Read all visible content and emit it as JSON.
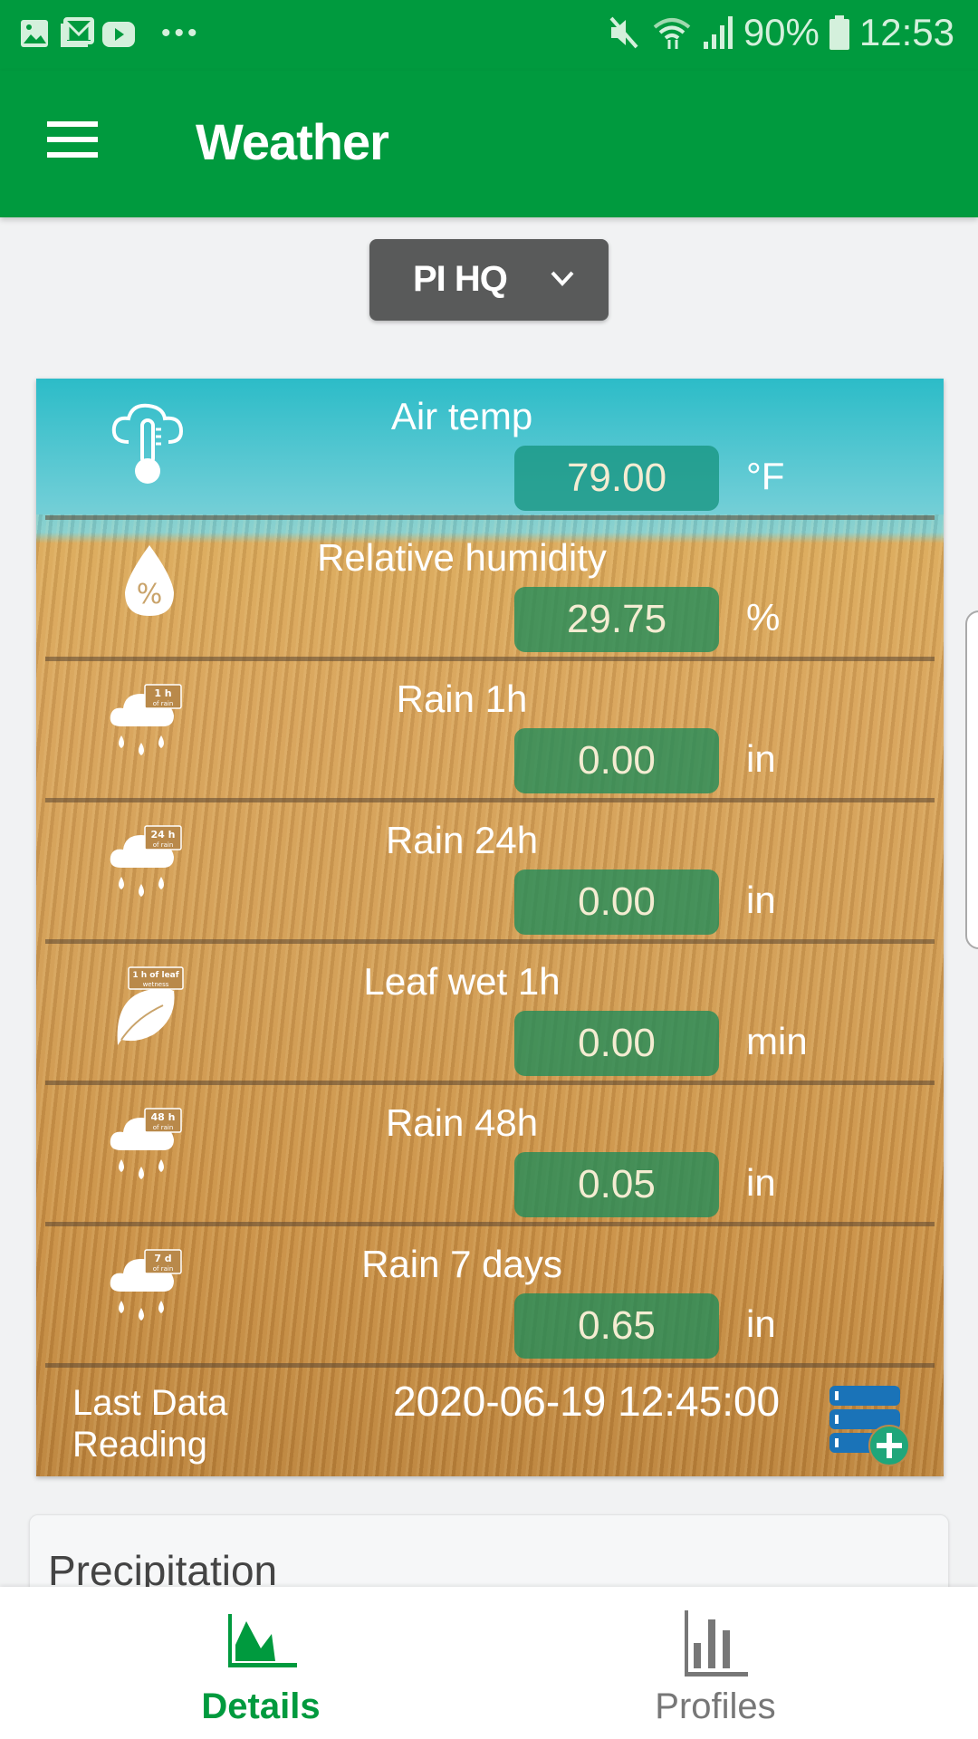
{
  "status_bar": {
    "notification_icons": [
      "gallery-icon",
      "gmail-icon",
      "youtube-icon"
    ],
    "more_indicator": "•••",
    "battery": "90%",
    "time": "12:53"
  },
  "app_bar": {
    "title": "Weather"
  },
  "station_selector": {
    "selected": "PI HQ"
  },
  "readings": [
    {
      "icon": "air-temp-icon",
      "label": "Air temp",
      "value": "79.00",
      "unit": "°F"
    },
    {
      "icon": "humidity-icon",
      "label": "Relative humidity",
      "value": "29.75",
      "unit": "%"
    },
    {
      "icon": "rain-1h-icon",
      "label": "Rain 1h",
      "value": "0.00",
      "unit": "in",
      "badge_top": "1 h",
      "badge_bottom": "of rain"
    },
    {
      "icon": "rain-24h-icon",
      "label": "Rain 24h",
      "value": "0.00",
      "unit": "in",
      "badge_top": "24 h",
      "badge_bottom": "of rain"
    },
    {
      "icon": "leaf-wetness-icon",
      "label": "Leaf wet 1h",
      "value": "0.00",
      "unit": "min",
      "badge_top": "1 h of leaf",
      "badge_bottom": "wetness"
    },
    {
      "icon": "rain-48h-icon",
      "label": "Rain 48h",
      "value": "0.05",
      "unit": "in",
      "badge_top": "48 h",
      "badge_bottom": "of rain"
    },
    {
      "icon": "rain-7d-icon",
      "label": "Rain 7 days",
      "value": "0.65",
      "unit": "in",
      "badge_top": "7 d",
      "badge_bottom": "of rain"
    }
  ],
  "last_reading": {
    "label": "Last Data Reading",
    "value": "2020-06-19 12:45:00"
  },
  "precipitation_card": {
    "title": "Precipitation"
  },
  "bottom_nav": {
    "items": [
      {
        "label": "Details",
        "active": true
      },
      {
        "label": "Profiles",
        "active": false
      }
    ]
  },
  "colors": {
    "brand_green": "#009a3e",
    "value_box": "#1e8c5a",
    "selector_bg": "#595a5a",
    "inactive_nav": "#777777"
  }
}
